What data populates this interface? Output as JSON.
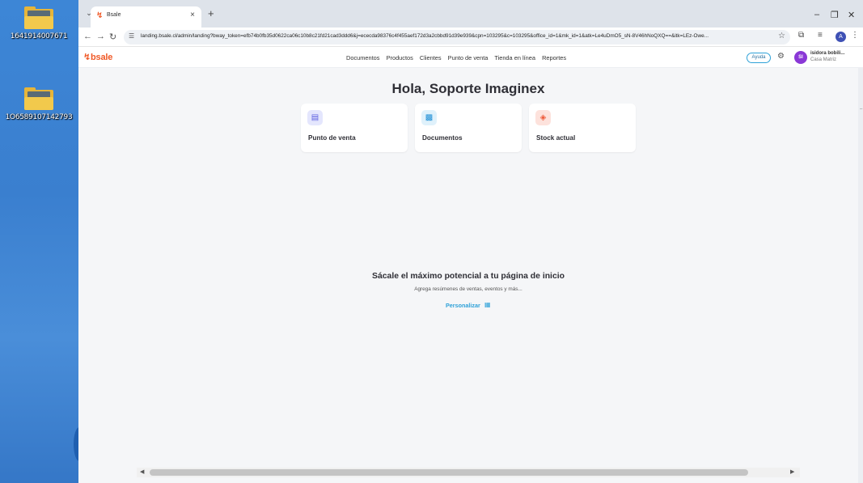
{
  "desktop": {
    "items": [
      {
        "label": "1641914007671"
      },
      {
        "label": "1O6589107142793"
      }
    ]
  },
  "browser": {
    "tab_title": "Bsale",
    "url": "landing.bsale.cl/admin/landing?bway_token=efb74b0fb35d0622ca06c10b8c21fd21cad3ddd6&j=ececda98376c4f455aef172d3a2cbbd91d39e939&cpn=103295&c=103295&office_id=1&mk_id=1&atk=Le4uDmO5_sN-8V46hNoQXQ==&itk=LEz-Owe...",
    "profile_initial": "A"
  },
  "header": {
    "logo": "bsale",
    "nav": [
      "Documentos",
      "Productos",
      "Clientes",
      "Punto de venta",
      "Tienda en línea",
      "Reportes"
    ],
    "help_label": "Ayuda",
    "avatar_initials": "SI",
    "user_name": "isidora bobili...",
    "user_branch": "Casa Matriz"
  },
  "main": {
    "greeting": "Hola, Soporte Imaginex",
    "cards": [
      {
        "label": "Punto de venta",
        "icon": "receipt-icon",
        "icon_bg": "#e4e6fd",
        "icon_color": "#5b5fe0"
      },
      {
        "label": "Documentos",
        "icon": "documents-icon",
        "icon_bg": "#dff1fb",
        "icon_color": "#1f8fd6"
      },
      {
        "label": "Stock actual",
        "icon": "box-icon",
        "icon_bg": "#fde2dc",
        "icon_color": "#ee5a3a"
      }
    ],
    "cta_title": "Sácale el máximo potencial a tu página de inicio",
    "cta_subtitle": "Agrega resúmenes de ventas, eventos y más...",
    "cta_link": "Personalizar"
  }
}
